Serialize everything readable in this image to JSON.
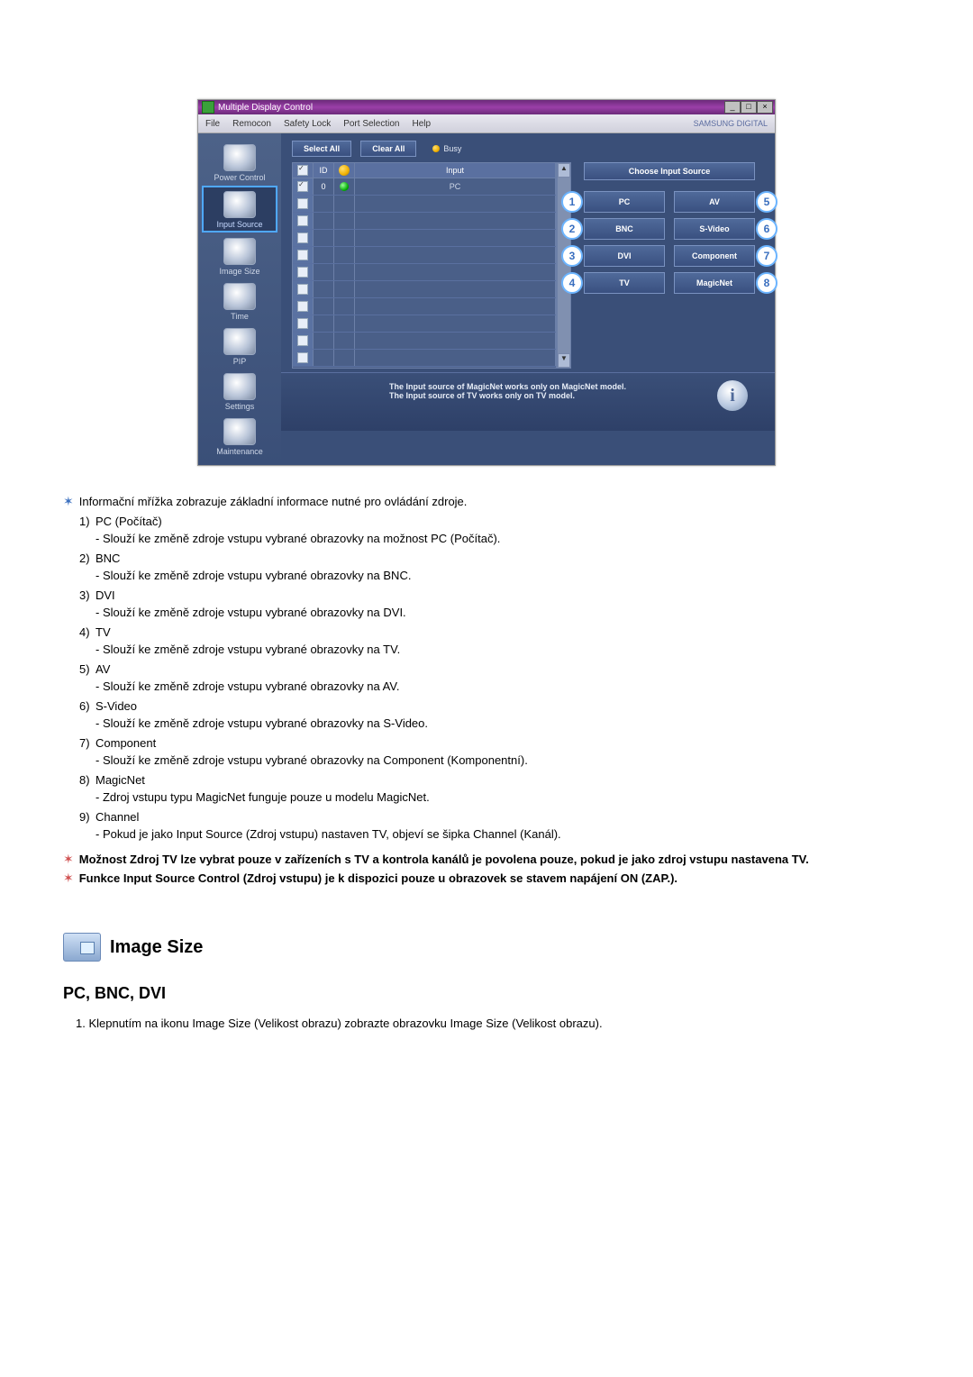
{
  "app": {
    "title": "Multiple Display Control",
    "brand": "SAMSUNG DIGITAL",
    "menu": [
      "File",
      "Remocon",
      "Safety Lock",
      "Port Selection",
      "Help"
    ],
    "sidebar": [
      {
        "label": "Power Control"
      },
      {
        "label": "Input Source"
      },
      {
        "label": "Image Size"
      },
      {
        "label": "Time"
      },
      {
        "label": "PIP"
      },
      {
        "label": "Settings"
      },
      {
        "label": "Maintenance"
      }
    ],
    "selected_sidebar_index": 1,
    "buttons": {
      "select_all": "Select All",
      "clear_all": "Clear All",
      "busy": "Busy"
    },
    "grid": {
      "columns": {
        "id": "ID",
        "input": "Input"
      },
      "first_row": {
        "id": "0",
        "input": "PC"
      },
      "empty_rows": 10
    },
    "panel_header": "Choose Input Source",
    "sources_left": [
      {
        "n": "1",
        "label": "PC"
      },
      {
        "n": "2",
        "label": "BNC"
      },
      {
        "n": "3",
        "label": "DVI"
      },
      {
        "n": "4",
        "label": "TV"
      }
    ],
    "sources_right": [
      {
        "n": "5",
        "label": "AV"
      },
      {
        "n": "6",
        "label": "S-Video"
      },
      {
        "n": "7",
        "label": "Component"
      },
      {
        "n": "8",
        "label": "MagicNet"
      }
    ],
    "note1": "The Input source of MagicNet works only on MagicNet model.",
    "note2": "The Input source of TV works only on TV model."
  },
  "doc": {
    "intro": "Informační mřížka zobrazuje základní informace nutné pro ovládání zdroje.",
    "items": [
      {
        "n": "1)",
        "t": "PC (Počítač)",
        "d": "- Slouží ke změně zdroje vstupu vybrané obrazovky na možnost PC (Počítač)."
      },
      {
        "n": "2)",
        "t": "BNC",
        "d": "- Slouží ke změně zdroje vstupu vybrané obrazovky na BNC."
      },
      {
        "n": "3)",
        "t": "DVI",
        "d": "- Slouží ke změně zdroje vstupu vybrané obrazovky na DVI."
      },
      {
        "n": "4)",
        "t": "TV",
        "d": "- Slouží ke změně zdroje vstupu vybrané obrazovky na TV."
      },
      {
        "n": "5)",
        "t": "AV",
        "d": "- Slouží ke změně zdroje vstupu vybrané obrazovky na AV."
      },
      {
        "n": "6)",
        "t": "S-Video",
        "d": "- Slouží ke změně zdroje vstupu vybrané obrazovky na S-Video."
      },
      {
        "n": "7)",
        "t": "Component",
        "d": "- Slouží ke změně zdroje vstupu vybrané obrazovky na Component (Komponentní)."
      },
      {
        "n": "8)",
        "t": "MagicNet",
        "d": "- Zdroj vstupu typu MagicNet funguje pouze u modelu MagicNet."
      },
      {
        "n": "9)",
        "t": "Channel",
        "d": "- Pokud je jako Input Source (Zdroj vstupu) nastaven TV, objeví se šipka Channel (Kanál)."
      }
    ],
    "bold_note1": "Možnost Zdroj TV lze vybrat pouze v zařízeních s TV a kontrola kanálů je povolena pouze, pokud je jako zdroj vstupu nastavena TV.",
    "bold_note2": "Funkce Input Source Control (Zdroj vstupu) je k dispozici pouze u obrazovek se stavem napájení ON (ZAP.).",
    "section_title": "Image Size",
    "sub_title": "PC, BNC, DVI",
    "sub_item": "1.  Klepnutím na ikonu Image Size (Velikost obrazu) zobrazte obrazovku Image Size (Velikost obrazu)."
  }
}
